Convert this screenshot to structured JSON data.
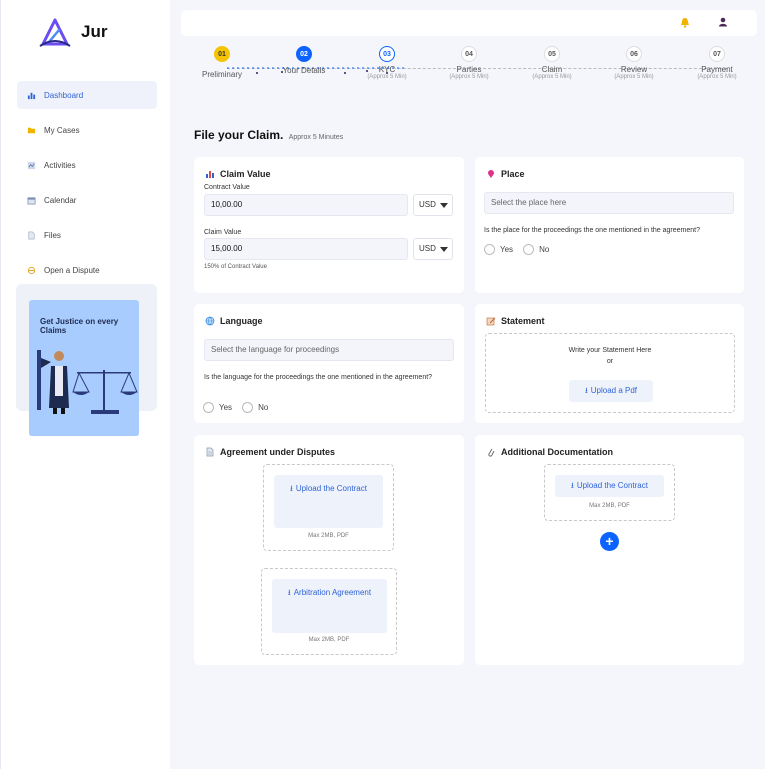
{
  "app": {
    "name": "Jur"
  },
  "sidebar": {
    "items": [
      {
        "label": "Dashboard",
        "icon": "chart-icon",
        "active": true
      },
      {
        "label": "My Cases",
        "icon": "folder-icon"
      },
      {
        "label": "Activities",
        "icon": "activity-icon"
      },
      {
        "label": "Calendar",
        "icon": "calendar-icon"
      },
      {
        "label": "Files",
        "icon": "file-icon"
      },
      {
        "label": "Open a Dispute",
        "icon": "dispute-icon"
      }
    ],
    "promo": {
      "text": "Get Justice on every Claims"
    }
  },
  "stepper": {
    "steps": [
      {
        "num": "01",
        "label": "Preliminary",
        "sub": ""
      },
      {
        "num": "02",
        "label": "Your Details",
        "sub": ""
      },
      {
        "num": "03",
        "label": "KYC",
        "sub": "(Approx 5 Min)"
      },
      {
        "num": "04",
        "label": "Parties",
        "sub": "(Approx 5 Min)"
      },
      {
        "num": "05",
        "label": "Claim",
        "sub": "(Approx 5 Min)"
      },
      {
        "num": "06",
        "label": "Review",
        "sub": "(Approx 5 Min)"
      },
      {
        "num": "07",
        "label": "Payment",
        "sub": "(Approx 5 Min)"
      }
    ]
  },
  "page": {
    "title": "File your Claim.",
    "subtitle": "Approx 5 Minutes"
  },
  "claim_value": {
    "title": "Claim Value",
    "contract_label": "Contract Value",
    "contract_value": "10,00.00",
    "contract_currency": "USD",
    "claim_label": "Claim Value",
    "claim_value": "15,00.00",
    "claim_currency": "USD",
    "note": "150% of Contract Value"
  },
  "place": {
    "title": "Place",
    "placeholder": "Select the place here",
    "question": "Is the place for the proceedings the one mentioned in the agreement?",
    "yes": "Yes",
    "no": "No"
  },
  "language": {
    "title": "Language",
    "placeholder": "Select the language for proceedings",
    "question": "Is the language for the proceedings the one mentioned in the agreement?",
    "yes": "Yes",
    "no": "No"
  },
  "statement": {
    "title": "Statement",
    "write": "Write your Statement Here",
    "or": "or",
    "upload": "Upload a Pdf"
  },
  "agreement": {
    "title": "Agreement under Disputes",
    "upload_contract": "Upload the Contract",
    "contract_note": "Max 2MB, PDF",
    "arbitration": "Arbitration Agreement",
    "arbitration_note": "Max 2MB, PDF"
  },
  "additional": {
    "title": "Additional Documentation",
    "upload_contract": "Upload the Contract",
    "note": "Max 2MB, PDF",
    "add": "+"
  },
  "colors": {
    "accent": "#0c63ff",
    "step_done": "#f5c400",
    "page_bg": "#f4f6fc"
  }
}
